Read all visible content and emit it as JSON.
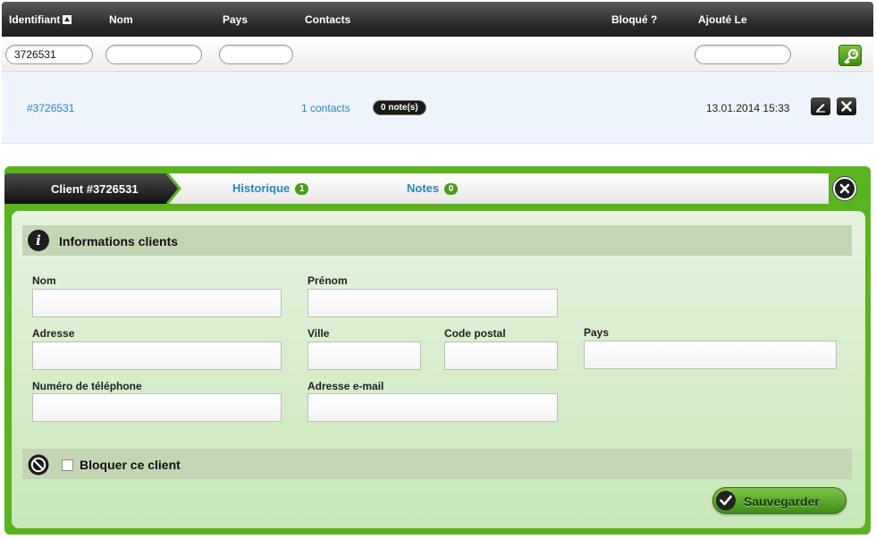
{
  "header": {
    "identifiant": "Identifiant",
    "nom": "Nom",
    "pays": "Pays",
    "contacts": "Contacts",
    "bloque": "Bloqué ?",
    "ajoute": "Ajouté Le"
  },
  "filters": {
    "identifiant_value": "3726531",
    "nom_value": "",
    "pays_value": "",
    "ajoute_value": ""
  },
  "row": {
    "id": "#3726531",
    "contacts": "1 contacts",
    "notes": "0 note(s)",
    "date": "13.01.2014 15:33"
  },
  "panel": {
    "active_tab": "Client #3726531",
    "tabs": [
      {
        "label": "Historique",
        "count": "1"
      },
      {
        "label": "Notes",
        "count": "0"
      }
    ],
    "section_title": "Informations clients",
    "fields": {
      "nom": {
        "label": "Nom",
        "value": ""
      },
      "prenom": {
        "label": "Prénom",
        "value": ""
      },
      "adresse": {
        "label": "Adresse",
        "value": ""
      },
      "ville": {
        "label": "Ville",
        "value": ""
      },
      "code_postal": {
        "label": "Code postal",
        "value": ""
      },
      "pays": {
        "label": "Pays",
        "value": ""
      },
      "telephone": {
        "label": "Numéro de téléphone",
        "value": ""
      },
      "email": {
        "label": "Adresse e-mail",
        "value": ""
      }
    },
    "block_label": "Bloquer ce client",
    "block_checked": false,
    "save_label": "Sauvegarder"
  },
  "colors": {
    "accent_green": "#59b41f",
    "link_blue": "#2a86c5",
    "header_dark": "#2d2d2d"
  }
}
